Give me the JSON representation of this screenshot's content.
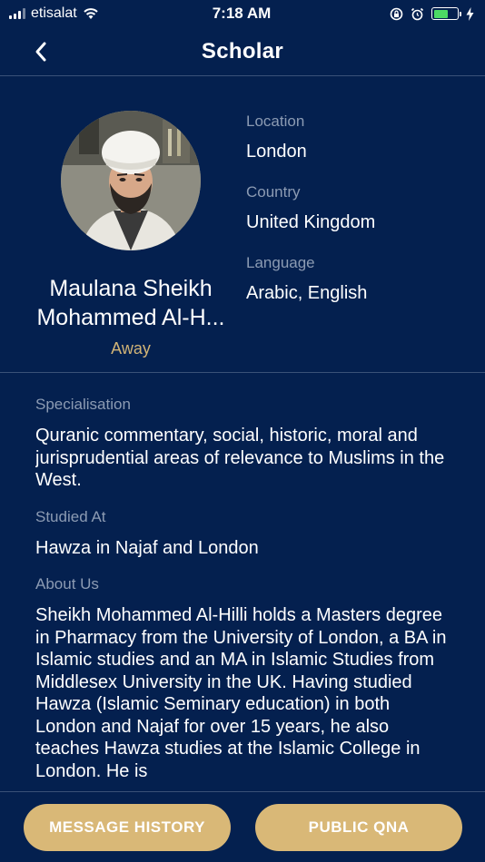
{
  "status_bar": {
    "carrier": "etisalat",
    "time": "7:18 AM",
    "battery_level": 0.6,
    "icons": [
      "signal-icon",
      "wifi-icon",
      "screen-lock-icon",
      "alarm-icon",
      "battery-icon",
      "charging-icon"
    ]
  },
  "header": {
    "title": "Scholar",
    "back_icon": "chevron-left-icon"
  },
  "profile": {
    "name_line1": "Maulana Sheikh",
    "name_line2": "Mohammed Al-H...",
    "status": "Away",
    "location_label": "Location",
    "location": "London",
    "country_label": "Country",
    "country": "United Kingdom",
    "language_label": "Language",
    "language": "Arabic, English"
  },
  "info": {
    "specialisation_label": "Specialisation",
    "specialisation": "Quranic commentary, social, historic, moral and jurisprudential areas of relevance to Muslims in the West.",
    "studied_label": "Studied At",
    "studied": "Hawza in Najaf and London",
    "about_label": "About Us",
    "about": "Sheikh Mohammed Al-Hilli holds a Masters degree in Pharmacy from the University of London, a BA in Islamic studies and an MA in Islamic Studies from Middlesex University in the UK. Having studied Hawza (Islamic Seminary education) in both London and Najaf for over 15 years, he also teaches Hawza studies at the Islamic College in London.  He is"
  },
  "actions": {
    "message_history": "MESSAGE HISTORY",
    "public_qna": "PUBLIC QNA"
  },
  "colors": {
    "background": "#04204f",
    "accent_gold": "#d9b877",
    "status_gold": "#d2b476",
    "label_gray": "#8c9bb3",
    "divider": "#3a5178"
  }
}
